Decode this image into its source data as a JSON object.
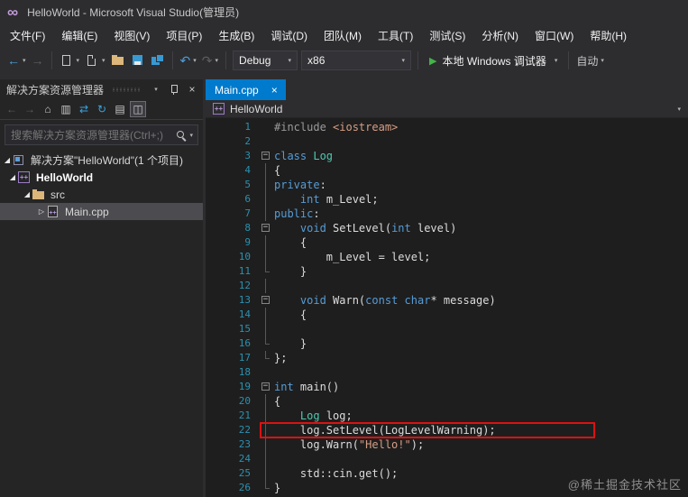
{
  "window": {
    "title": "HelloWorld - Microsoft Visual Studio(管理员)"
  },
  "menu": {
    "items": [
      "文件(F)",
      "编辑(E)",
      "视图(V)",
      "项目(P)",
      "生成(B)",
      "调试(D)",
      "团队(M)",
      "工具(T)",
      "测试(S)",
      "分析(N)",
      "窗口(W)",
      "帮助(H)"
    ]
  },
  "toolbar": {
    "configuration": "Debug",
    "platform": "x86",
    "run_label": "本地 Windows 调试器",
    "auto_label": "自动"
  },
  "solution_explorer": {
    "title": "解决方案资源管理器",
    "search_placeholder": "搜索解决方案资源管理器(Ctrl+;)",
    "tree": {
      "solution": "解决方案\"HelloWorld\"(1 个项目)",
      "project": "HelloWorld",
      "folder": "src",
      "file": "Main.cpp"
    }
  },
  "editor": {
    "tab": "Main.cpp",
    "breadcrumb": "HelloWorld",
    "code_lines": [
      {
        "n": 1,
        "fold": "",
        "segs": [
          [
            "pp",
            "#include "
          ],
          [
            "str",
            "<iostream>"
          ]
        ]
      },
      {
        "n": 2,
        "fold": "",
        "segs": []
      },
      {
        "n": 3,
        "fold": "box",
        "segs": [
          [
            "kw",
            "class"
          ],
          [
            "pl",
            " "
          ],
          [
            "ty",
            "Log"
          ]
        ]
      },
      {
        "n": 4,
        "fold": "line",
        "segs": [
          [
            "pl",
            "{"
          ]
        ]
      },
      {
        "n": 5,
        "fold": "line",
        "segs": [
          [
            "kw",
            "private"
          ],
          [
            "pl",
            ":"
          ]
        ]
      },
      {
        "n": 6,
        "fold": "line",
        "segs": [
          [
            "pl",
            "    "
          ],
          [
            "kw",
            "int"
          ],
          [
            "pl",
            " m_Level;"
          ]
        ]
      },
      {
        "n": 7,
        "fold": "line",
        "segs": [
          [
            "kw",
            "public"
          ],
          [
            "pl",
            ":"
          ]
        ]
      },
      {
        "n": 8,
        "fold": "box",
        "segs": [
          [
            "pl",
            "    "
          ],
          [
            "kw",
            "void"
          ],
          [
            "pl",
            " SetLevel("
          ],
          [
            "kw",
            "int"
          ],
          [
            "pl",
            " level)"
          ]
        ]
      },
      {
        "n": 9,
        "fold": "line",
        "segs": [
          [
            "pl",
            "    {"
          ]
        ]
      },
      {
        "n": 10,
        "fold": "line",
        "segs": [
          [
            "pl",
            "        m_Level = level;"
          ]
        ]
      },
      {
        "n": 11,
        "fold": "end",
        "segs": [
          [
            "pl",
            "    }"
          ]
        ]
      },
      {
        "n": 12,
        "fold": "line",
        "segs": []
      },
      {
        "n": 13,
        "fold": "box",
        "segs": [
          [
            "pl",
            "    "
          ],
          [
            "kw",
            "void"
          ],
          [
            "pl",
            " Warn("
          ],
          [
            "kw",
            "const"
          ],
          [
            "pl",
            " "
          ],
          [
            "kw",
            "char"
          ],
          [
            "pl",
            "* message)"
          ]
        ]
      },
      {
        "n": 14,
        "fold": "line",
        "segs": [
          [
            "pl",
            "    {"
          ]
        ]
      },
      {
        "n": 15,
        "fold": "line",
        "segs": []
      },
      {
        "n": 16,
        "fold": "end",
        "segs": [
          [
            "pl",
            "    }"
          ]
        ]
      },
      {
        "n": 17,
        "fold": "end",
        "segs": [
          [
            "pl",
            "};"
          ]
        ]
      },
      {
        "n": 18,
        "fold": "",
        "segs": []
      },
      {
        "n": 19,
        "fold": "box",
        "segs": [
          [
            "kw",
            "int"
          ],
          [
            "pl",
            " main()"
          ]
        ]
      },
      {
        "n": 20,
        "fold": "line",
        "segs": [
          [
            "pl",
            "{"
          ]
        ]
      },
      {
        "n": 21,
        "fold": "line",
        "segs": [
          [
            "pl",
            "    "
          ],
          [
            "ty",
            "Log"
          ],
          [
            "pl",
            " log;"
          ]
        ]
      },
      {
        "n": 22,
        "fold": "line",
        "highlight": true,
        "segs": [
          [
            "pl",
            "    log.SetLevel(LogLevelWarning);"
          ]
        ]
      },
      {
        "n": 23,
        "fold": "line",
        "segs": [
          [
            "pl",
            "    log.Warn("
          ],
          [
            "str",
            "\"Hello!\""
          ],
          [
            "pl",
            ");"
          ]
        ]
      },
      {
        "n": 24,
        "fold": "line",
        "segs": []
      },
      {
        "n": 25,
        "fold": "line",
        "segs": [
          [
            "pl",
            "    std::cin.get();"
          ]
        ]
      },
      {
        "n": 26,
        "fold": "end",
        "segs": [
          [
            "pl",
            "}"
          ]
        ]
      }
    ]
  },
  "watermark": "@稀土掘金技术社区",
  "colors": {
    "accent": "#007acc",
    "keyword": "#569cd6",
    "type": "#4ec9b0",
    "string": "#d69d85",
    "preprocessor": "#9b9b9b",
    "line_number": "#2b91af",
    "editor_background": "#1e1e1e",
    "chrome_background": "#2d2d30",
    "panel_background": "#252526",
    "highlight_box": "#da1212"
  }
}
